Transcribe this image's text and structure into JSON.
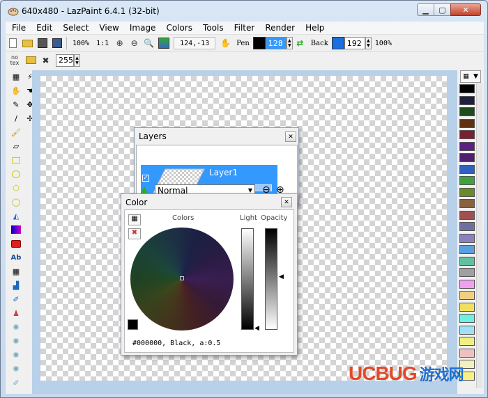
{
  "window": {
    "title": "640x480 - LazPaint 6.4.1 (32-bit)"
  },
  "menu": [
    "File",
    "Edit",
    "Select",
    "View",
    "Image",
    "Colors",
    "Tools",
    "Filter",
    "Render",
    "Help"
  ],
  "toolbar": {
    "zoom_percent": "100%",
    "zoom_ratio": "1:1",
    "cursor_pos": "124,-13",
    "pen_label": "Pen",
    "pen_value": "128",
    "back_label": "Back",
    "back_value": "192",
    "opacity_percent": "100%",
    "no_texture_label": "no\ntex",
    "tolerance_value": "255"
  },
  "colors": {
    "pen_color": "#000000",
    "back_color": "#1b6fe0",
    "accent": "#3399ff"
  },
  "layers_panel": {
    "title": "Layers",
    "layer_name": "Layer1",
    "blend_mode": "Normal"
  },
  "color_panel": {
    "title": "Color",
    "colors_label": "Colors",
    "light_label": "Light",
    "opacity_label": "Opacity",
    "readout": "#000000, Black, a:0.5"
  },
  "palette": [
    "#000000",
    "#1f1f40",
    "#1e4a1e",
    "#603010",
    "#7a2030",
    "#5b2080",
    "#502070",
    "#3060c0",
    "#40a040",
    "#6a8a2a",
    "#8a6040",
    "#a05050",
    "#7070a0",
    "#8a80c0",
    "#5aa0e0",
    "#60c0a0",
    "#a0a0a0",
    "#f0a0f0",
    "#f0d080",
    "#f0e060",
    "#70f0e0",
    "#a0e0f0",
    "#f0f080",
    "#f0c0c0",
    "#f0f0c0",
    "#f8f080"
  ],
  "watermark": {
    "brand": "UCBUG",
    "suffix": "游戏网"
  }
}
